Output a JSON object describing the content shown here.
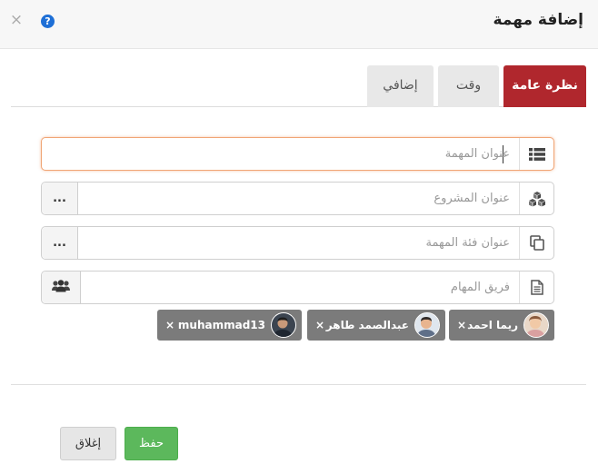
{
  "dialog": {
    "title": "إضافة مهمة",
    "close_glyph": "×",
    "help_glyph": "?"
  },
  "tabs": [
    {
      "label": "نظرة عامة",
      "active": true
    },
    {
      "label": "وقت",
      "active": false
    },
    {
      "label": "إضافي",
      "active": false
    }
  ],
  "form": {
    "task_title": {
      "placeholder": "عنوان المهمة",
      "value": "",
      "icon": "list-icon"
    },
    "project_title": {
      "placeholder": "عنوان المشروع",
      "value": "",
      "icon": "cubes-icon",
      "button": "..."
    },
    "category_title": {
      "placeholder": "عنوان فئة المهمة",
      "value": "",
      "icon": "copy-icon",
      "button": "..."
    },
    "task_team": {
      "placeholder": "فريق المهام",
      "value": "",
      "icon": "file-text-icon",
      "button_icon": "users-icon"
    }
  },
  "team_members": [
    {
      "name": "ريما احمد",
      "remove": "×"
    },
    {
      "name": "عبدالصمد طاهر",
      "remove": "×"
    },
    {
      "name": "muhammad13",
      "remove": "×"
    }
  ],
  "footer": {
    "save_label": "حفظ",
    "close_label": "إغلاق"
  },
  "colors": {
    "active_tab": "#b0272d",
    "save": "#5cb85c",
    "help": "#1e6fd6",
    "chip": "#7b7b7b"
  }
}
